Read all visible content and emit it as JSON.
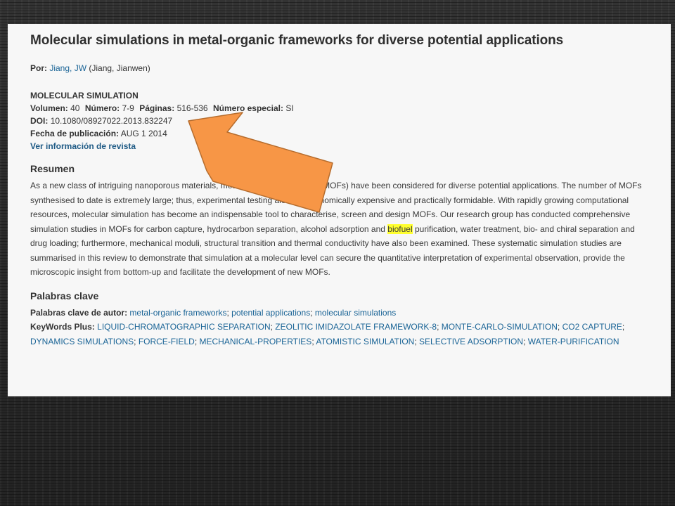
{
  "record": {
    "title": "Molecular simulations in metal-organic frameworks for diverse potential applications",
    "author_label": "Por:",
    "author_link": "Jiang, JW",
    "author_full": "(Jiang, Jianwen)",
    "journal": "MOLECULAR SIMULATION",
    "volume_label": "Volumen:",
    "volume": "40",
    "issue_label": "Número:",
    "issue": "7-9",
    "pages_label": "Páginas:",
    "pages": "516-536",
    "special_label": "Número especial:",
    "special": "SI",
    "doi_label": "DOI:",
    "doi": "10.1080/08927022.2013.832247",
    "pubdate_label": "Fecha de publicación:",
    "pubdate": "AUG 1 2014",
    "journal_info_link": "Ver información de revista"
  },
  "abstract": {
    "heading": "Resumen",
    "text_before": "As a new class of intriguing nanoporous materials, metal-organic frameworks (MOFs) have been considered for diverse potential applications. The number of MOFs synthesised to date is extremely large; thus, experimental testing alone is economically expensive and practically formidable. With rapidly growing computational resources, molecular simulation has become an indispensable tool to characterise, screen and design MOFs. Our research group has conducted comprehensive simulation studies in MOFs for carbon capture, hydrocarbon separation, alcohol adsorption and ",
    "highlighted": "biofuel",
    "text_after": " purification, water treatment, bio- and chiral separation and drug loading; furthermore, mechanical moduli, structural transition and thermal conductivity have also been examined. These systematic simulation studies are summarised in this review to demonstrate that simulation at a molecular level can secure the quantitative interpretation of experimental observation, provide the microscopic insight from bottom-up and facilitate the development of new MOFs."
  },
  "keywords": {
    "heading": "Palabras clave",
    "author_label": "Palabras clave de autor:",
    "author_keywords": [
      "metal-organic frameworks",
      "potential applications",
      "molecular simulations"
    ],
    "plus_label": "KeyWords Plus:",
    "plus_keywords": [
      "LIQUID-CHROMATOGRAPHIC SEPARATION",
      "ZEOLITIC IMIDAZOLATE FRAMEWORK-8",
      "MONTE-CARLO-SIMULATION",
      "CO2 CAPTURE",
      "DYNAMICS SIMULATIONS",
      "FORCE-FIELD",
      "MECHANICAL-PROPERTIES",
      "ATOMISTIC SIMULATION",
      "SELECTIVE ADSORPTION",
      "WATER-PURIFICATION"
    ]
  },
  "annotation": {
    "icon": "arrow-up-left-icon",
    "fill_color": "#f79646",
    "stroke_color": "#b66d2e"
  },
  "colors": {
    "link": "#1a6496",
    "highlight": "#ffff2e",
    "panel_bg": "#f7f7f7"
  }
}
